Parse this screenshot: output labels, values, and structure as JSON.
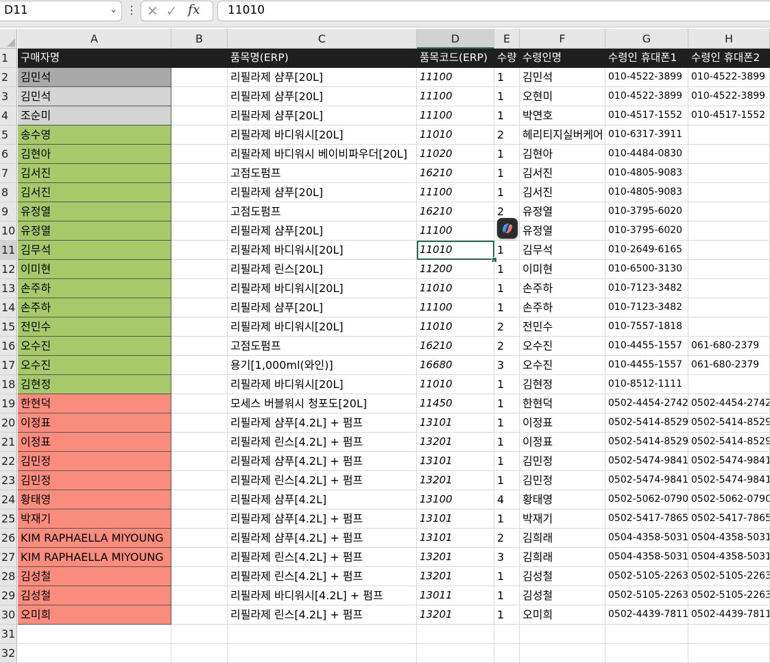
{
  "formula_bar": {
    "name_box": "D11",
    "name_box_arrow": "chevron-down-icon",
    "more": "⋮",
    "cancel": "✕",
    "enter": "✓",
    "fx": "fx",
    "value": "11010"
  },
  "columns": [
    "A",
    "B",
    "C",
    "D",
    "E",
    "F",
    "G",
    "H"
  ],
  "selected_column": "D",
  "selected_row": 11,
  "header_row": [
    "구매자명",
    "",
    "품목명(ERP)",
    "품목코드(ERP)",
    "수량",
    "수령인명",
    "수령인 휴대폰1",
    "수령인 휴대폰2"
  ],
  "rows": [
    {
      "n": "2",
      "fill": "dark",
      "a": "김민석",
      "c": "리필라제 샴푸[20L]",
      "d": "11100",
      "e": "1",
      "f": "김민석",
      "g": "010-4522-3899",
      "h": "010-4522-3899"
    },
    {
      "n": "3",
      "fill": "light",
      "a": "김민석",
      "c": "리필라제 샴푸[20L]",
      "d": "11100",
      "e": "1",
      "f": "오현미",
      "g": "010-4522-3899",
      "h": "010-4522-3899"
    },
    {
      "n": "4",
      "fill": "light",
      "a": "조순미",
      "c": "리필라제 샴푸[20L]",
      "d": "11100",
      "e": "1",
      "f": "박연호",
      "g": "010-4517-1552",
      "h": "010-4517-1552"
    },
    {
      "n": "5",
      "fill": "green",
      "a": "송수영",
      "c": "리필라제 바디워시[20L]",
      "d": "11010",
      "e": "2",
      "f": "헤리티지실버케어",
      "g": "010-6317-3911",
      "h": ""
    },
    {
      "n": "6",
      "fill": "green",
      "a": "김현아",
      "c": "리필라제 바디워시 베이비파우더[20L]",
      "d": "11020",
      "e": "1",
      "f": "김현아",
      "g": "010-4484-0830",
      "h": ""
    },
    {
      "n": "7",
      "fill": "green",
      "a": "김서진",
      "c": "고점도펌프",
      "d": "16210",
      "e": "1",
      "f": "김서진",
      "g": "010-4805-9083",
      "h": ""
    },
    {
      "n": "8",
      "fill": "green",
      "a": "김서진",
      "c": "리필라제 샴푸[20L]",
      "d": "11100",
      "e": "1",
      "f": "김서진",
      "g": "010-4805-9083",
      "h": ""
    },
    {
      "n": "9",
      "fill": "green",
      "a": "유정열",
      "c": "고점도펌프",
      "d": "16210",
      "e": "2",
      "f": "유정열",
      "g": "010-3795-6020",
      "h": ""
    },
    {
      "n": "10",
      "fill": "green",
      "a": "유정열",
      "c": "리필라제 샴푸[20L]",
      "d": "11100",
      "e": "",
      "f": "유정열",
      "g": "010-3795-6020",
      "h": ""
    },
    {
      "n": "11",
      "fill": "green",
      "a": "김무석",
      "c": "리필라제 바디워시[20L]",
      "d": "11010",
      "e": "1",
      "f": "김무석",
      "g": "010-2649-6165",
      "h": ""
    },
    {
      "n": "12",
      "fill": "green",
      "a": "이미현",
      "c": "리필라제 린스[20L]",
      "d": "11200",
      "e": "1",
      "f": "이미현",
      "g": "010-6500-3130",
      "h": ""
    },
    {
      "n": "13",
      "fill": "green",
      "a": "손주하",
      "c": "리필라제 바디워시[20L]",
      "d": "11010",
      "e": "1",
      "f": "손주하",
      "g": "010-7123-3482",
      "h": ""
    },
    {
      "n": "14",
      "fill": "green",
      "a": "손주하",
      "c": "리필라제 샴푸[20L]",
      "d": "11100",
      "e": "1",
      "f": "손주하",
      "g": "010-7123-3482",
      "h": ""
    },
    {
      "n": "15",
      "fill": "green",
      "a": "전민수",
      "c": "리필라제 바디워시[20L]",
      "d": "11010",
      "e": "2",
      "f": "전민수",
      "g": "010-7557-1818",
      "h": ""
    },
    {
      "n": "16",
      "fill": "green",
      "a": "오수진",
      "c": "고점도펌프",
      "d": "16210",
      "e": "2",
      "f": "오수진",
      "g": "010-4455-1557",
      "h": "061-680-2379"
    },
    {
      "n": "17",
      "fill": "green",
      "a": "오수진",
      "c": "용기[1,000ml(와인)]",
      "d": "16680",
      "e": "3",
      "f": "오수진",
      "g": "010-4455-1557",
      "h": "061-680-2379"
    },
    {
      "n": "18",
      "fill": "green",
      "a": "김현정",
      "c": "리필라제 바디워시[20L]",
      "d": "11010",
      "e": "1",
      "f": "김현정",
      "g": "010-8512-1111",
      "h": ""
    },
    {
      "n": "19",
      "fill": "red",
      "a": "한현덕",
      "c": "모세스 버블워시 청포도[20L]",
      "d": "11450",
      "e": "1",
      "f": "한현덕",
      "g": "0502-4454-2742",
      "h": "0502-4454-2742"
    },
    {
      "n": "20",
      "fill": "red",
      "a": "이정표",
      "c": "리필라제 샴푸[4.2L] + 펌프",
      "d": "13101",
      "e": "1",
      "f": "이정표",
      "g": "0502-5414-8529",
      "h": "0502-5414-8529"
    },
    {
      "n": "21",
      "fill": "red",
      "a": "이정표",
      "c": "리필라제 린스[4.2L] + 펌프",
      "d": "13201",
      "e": "1",
      "f": "이정표",
      "g": "0502-5414-8529",
      "h": "0502-5414-8529"
    },
    {
      "n": "22",
      "fill": "red",
      "a": "김민정",
      "c": "리필라제 샴푸[4.2L] + 펌프",
      "d": "13101",
      "e": "1",
      "f": "김민정",
      "g": "0502-5474-9841",
      "h": "0502-5474-9841"
    },
    {
      "n": "23",
      "fill": "red",
      "a": "김민정",
      "c": "리필라제 린스[4.2L] + 펌프",
      "d": "13201",
      "e": "1",
      "f": "김민정",
      "g": "0502-5474-9841",
      "h": "0502-5474-9841"
    },
    {
      "n": "24",
      "fill": "red",
      "a": "황태영",
      "c": "리필라제 샴푸[4.2L]",
      "d": "13100",
      "e": "4",
      "f": "황태영",
      "g": "0502-5062-0790",
      "h": "0502-5062-0790"
    },
    {
      "n": "25",
      "fill": "red",
      "a": "박재기",
      "c": "리필라제 샴푸[4.2L] + 펌프",
      "d": "13101",
      "e": "1",
      "f": "박재기",
      "g": "0502-5417-7865",
      "h": "0502-5417-7865"
    },
    {
      "n": "26",
      "fill": "red",
      "a": "KIM RAPHAELLA MIYOUNG",
      "c": "리필라제 샴푸[4.2L] + 펌프",
      "d": "13101",
      "e": "2",
      "f": "김희래",
      "g": "0504-4358-5031",
      "h": "0504-4358-5031"
    },
    {
      "n": "27",
      "fill": "red",
      "a": "KIM RAPHAELLA MIYOUNG",
      "c": "리필라제 린스[4.2L] + 펌프",
      "d": "13201",
      "e": "3",
      "f": "김희래",
      "g": "0504-4358-5031",
      "h": "0504-4358-5031"
    },
    {
      "n": "28",
      "fill": "red",
      "a": "김성철",
      "c": "리필라제 린스[4.2L] + 펌프",
      "d": "13201",
      "e": "1",
      "f": "김성철",
      "g": "0502-5105-2263",
      "h": "0502-5105-2263"
    },
    {
      "n": "29",
      "fill": "red",
      "a": "김성철",
      "c": "리필라제 바디워시[4.2L] + 펌프",
      "d": "13011",
      "e": "1",
      "f": "김성철",
      "g": "0502-5105-2263",
      "h": "0502-5105-2263"
    },
    {
      "n": "30",
      "fill": "red",
      "a": "오미희",
      "c": "리필라제 린스[4.2L] + 펌프",
      "d": "13201",
      "e": "1",
      "f": "오미희",
      "g": "0502-4439-7811",
      "h": "0502-4439-7811"
    },
    {
      "n": "31",
      "fill": "",
      "a": "",
      "c": "",
      "d": "",
      "e": "",
      "f": "",
      "g": "",
      "h": ""
    },
    {
      "n": "32",
      "fill": "",
      "a": "",
      "c": "",
      "d": "",
      "e": "",
      "f": "",
      "g": "",
      "h": ""
    }
  ],
  "row1_label": "1",
  "copilot_icon": "copilot-icon",
  "colors": {
    "header_fill": "#1f1f1f",
    "green_fill": "#a6c96a",
    "red_fill": "#f98c7c",
    "grey_fill": "#a9a9a9",
    "light_grey_fill": "#d4d4d4",
    "selection": "#1e7145"
  }
}
